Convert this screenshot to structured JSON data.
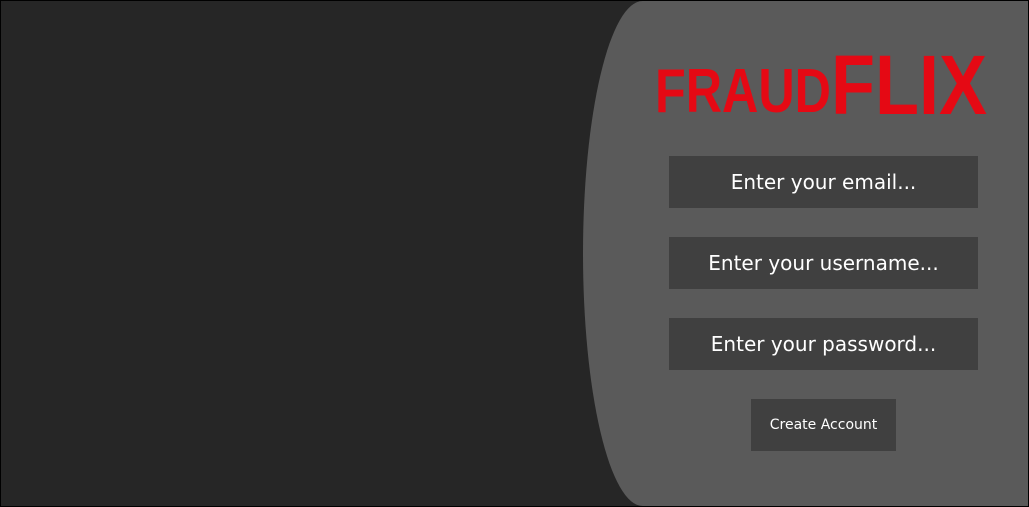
{
  "brand": {
    "logo_text_light": "FRAUD",
    "logo_text_bold": "FLIX",
    "logo_color": "#e50914"
  },
  "form": {
    "email_placeholder": "Enter your email...",
    "username_placeholder": "Enter your username...",
    "password_placeholder": "Enter your password...",
    "submit_label": "Create Account"
  },
  "colors": {
    "background": "#262626",
    "panel": "#5a5a5a",
    "field": "#404040",
    "text": "#ffffff"
  }
}
